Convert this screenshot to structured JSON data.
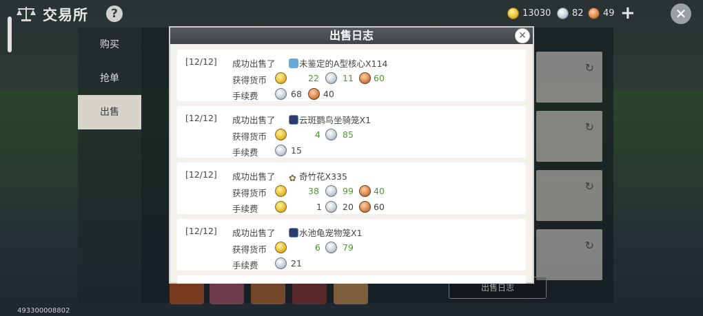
{
  "header": {
    "title": "交易所",
    "help": "?"
  },
  "currencies": {
    "gold": "13030",
    "silver": "82",
    "copper": "49"
  },
  "sidebar": {
    "items": [
      {
        "label": "购买"
      },
      {
        "label": "抢单"
      },
      {
        "label": "出售"
      }
    ]
  },
  "background": {
    "log_button": "出售日志"
  },
  "footer": {
    "id": "493300008802"
  },
  "modal": {
    "title": "出售日志",
    "entries": [
      {
        "date": "[12/12]",
        "action": "成功出售了",
        "item": "未鉴定的A型核心X114",
        "earned_label": "获得货币",
        "earned": {
          "gold": "22",
          "silver": "11",
          "copper": "60"
        },
        "fee_label": "手续费",
        "fee": {
          "silver": "68",
          "copper": "40"
        }
      },
      {
        "date": "[12/12]",
        "action": "成功出售了",
        "item": "云斑鹦鸟坐骑笼X1",
        "earned_label": "获得货币",
        "earned": {
          "gold": "4",
          "silver": "85"
        },
        "fee_label": "手续费",
        "fee": {
          "silver": "15"
        }
      },
      {
        "date": "[12/12]",
        "action": "成功出售了",
        "item": "奇竹花X335",
        "earned_label": "获得货币",
        "earned": {
          "gold": "38",
          "silver": "99",
          "copper": "40"
        },
        "fee_label": "手续费",
        "fee": {
          "gold": "1",
          "silver": "20",
          "copper": "60"
        }
      },
      {
        "date": "[12/12]",
        "action": "成功出售了",
        "item": "水池龟宠物笼X1",
        "earned_label": "获得货币",
        "earned": {
          "gold": "6",
          "silver": "79"
        },
        "fee_label": "手续费",
        "fee": {
          "silver": "21"
        }
      }
    ]
  }
}
